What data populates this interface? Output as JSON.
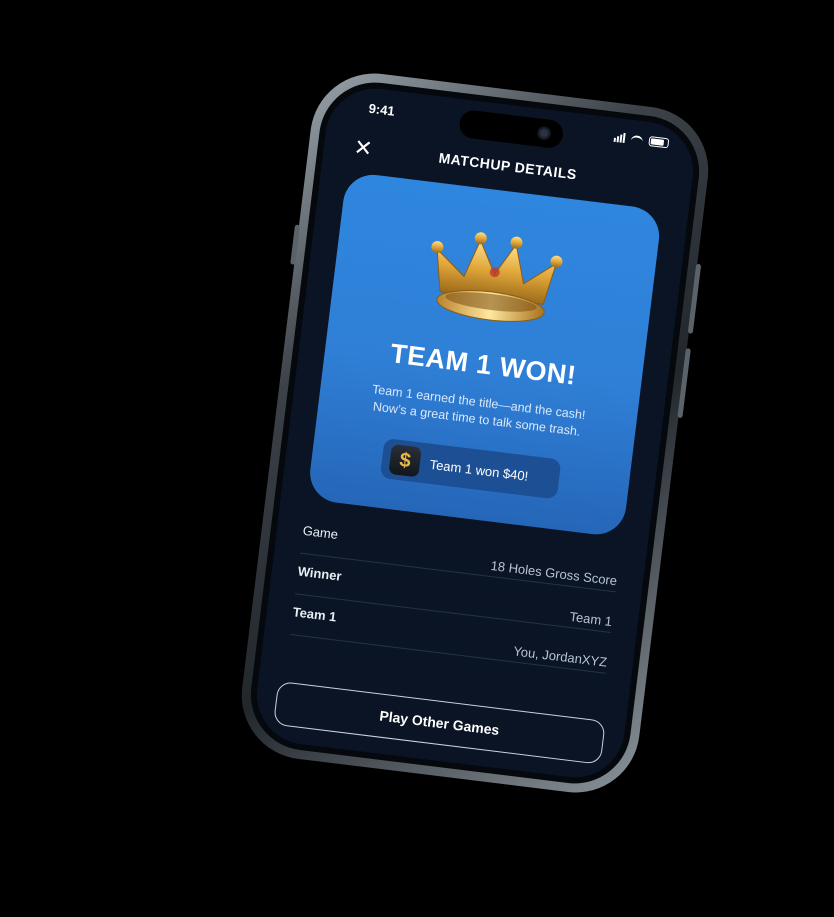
{
  "status": {
    "time": "9:41"
  },
  "nav": {
    "close_glyph": "✕",
    "title": "MATCHUP DETAILS"
  },
  "hero": {
    "icon": "crown-icon",
    "title": "TEAM 1 WON!",
    "subtitle": "Team 1 earned the title—and the cash! Now’s a great time to talk some trash.",
    "pill_icon_glyph": "$",
    "pill_label": "Team 1 won $40!"
  },
  "details": {
    "rows": [
      {
        "key": "Game",
        "value": "18 Holes Gross Score"
      },
      {
        "key": "Winner",
        "value": "Team 1"
      },
      {
        "key": "Team 1",
        "value": "You, JordanXYZ"
      }
    ]
  },
  "actions": {
    "play_label": "Play Other Games"
  },
  "colors": {
    "background": "#000000",
    "screen": "#0a1424",
    "card_blue": "#2f86de",
    "pill_blue": "#1d4f94",
    "gold": "#e9b84a"
  }
}
